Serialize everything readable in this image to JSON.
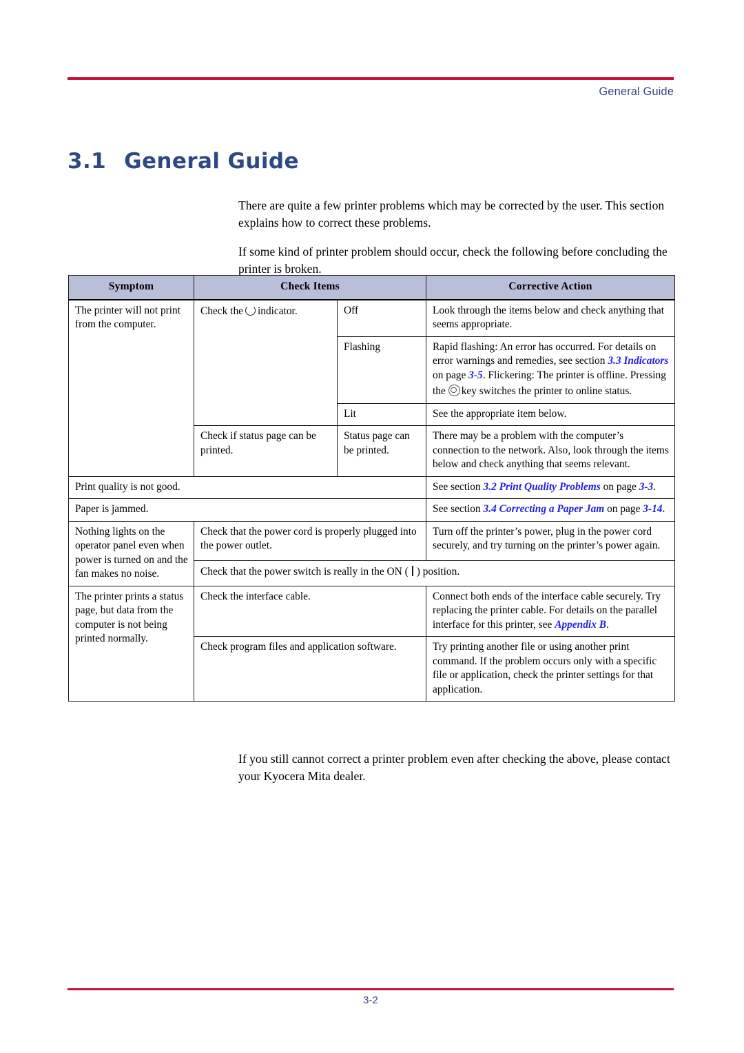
{
  "header": {
    "running_title": "General Guide",
    "rule_color": "#c8103e",
    "text_color": "#36467f"
  },
  "heading": {
    "number": "3.1",
    "title": "General Guide",
    "color": "#2e4884"
  },
  "intro": {
    "paragraph_1": "There are quite a few printer problems which may be corrected by the user. This section explains how to correct these problems.",
    "paragraph_2": "If some kind of printer problem should occur, check the following before concluding the printer is broken."
  },
  "table": {
    "columns": [
      "Symptom",
      "Check Items",
      "Corrective Action"
    ],
    "header_fill": "#b9bed9",
    "xref_color": "#2222e0",
    "rows": {
      "r1_symptom": "The printer will not print from the computer.",
      "r1_check_indicator_pre": "Check the",
      "r1_check_indicator_post": "indicator.",
      "r1_state_off": "Off",
      "r1_action_off": "Look through the items below and check anything that seems appropriate.",
      "r1_state_flashing": "Flashing",
      "r1_action_flashing_a": "Rapid flashing: An error has occurred. For details on error warnings and remedies, see section",
      "r1_action_flashing_xref_section": "3.3 Indicators",
      "r1_action_flashing_b": "on page",
      "r1_action_flashing_xref_page": "3-5",
      "r1_action_flashing_c": ".",
      "r1_action_flashing_d": "Flickering: The printer is offline. Pressing the",
      "r1_action_flashing_e": "key switches the printer to online status.",
      "r1_state_lit": "Lit",
      "r1_action_lit": "See the appropriate item below.",
      "r1_check_statuspage": "Check if status page can be printed.",
      "r1_state_statuspage": "Status page can be printed.",
      "r1_action_statuspage": "There may be a problem with the computer’s connection to the network. Also, look through the items below and check anything that seems relevant.",
      "r2_symptom": "Print quality is not good.",
      "r2_action_a": "See section",
      "r2_action_xref_section": "3.2 Print Quality Problems",
      "r2_action_b": "on page",
      "r2_action_xref_page": "3-3",
      "r2_action_c": ".",
      "r3_symptom": "Paper is jammed.",
      "r3_action_a": "See section",
      "r3_action_xref_section": "3.4 Correcting a Paper Jam",
      "r3_action_b": "on page",
      "r3_action_xref_page": "3-14",
      "r3_action_c": ".",
      "r4_symptom": "Nothing lights on the operator panel even when power is turned on and the fan makes no noise.",
      "r4_check_1": "Check that the power cord is properly plugged into the power outlet.",
      "r4_action_1": "Turn off the printer’s power, plug in the power cord securely, and try turning on the printer’s power again.",
      "r4_check_2_pre": "Check that the power switch is really in the ON (",
      "r4_check_2_post": ") position.",
      "r5_symptom": "The printer prints a status page, but data from the computer is not being printed normally.",
      "r5_check_1": "Check the interface cable.",
      "r5_action_1_a": "Connect both ends of the interface cable securely. Try replacing the printer cable. For details on the parallel interface for this printer, see",
      "r5_action_1_xref": "Appendix B",
      "r5_action_1_b": ".",
      "r5_check_2": "Check program files and application software.",
      "r5_action_2": "Try printing another file or using another print command. If the problem occurs only with a specific file or application, check the printer settings for that application."
    }
  },
  "outro": {
    "paragraph_1": "If you still cannot correct a printer problem even after checking the above, please contact your Kyocera Mita dealer."
  },
  "footer": {
    "page_number": "3-2",
    "rule_color": "#c8103e",
    "text_color": "#36467f"
  }
}
